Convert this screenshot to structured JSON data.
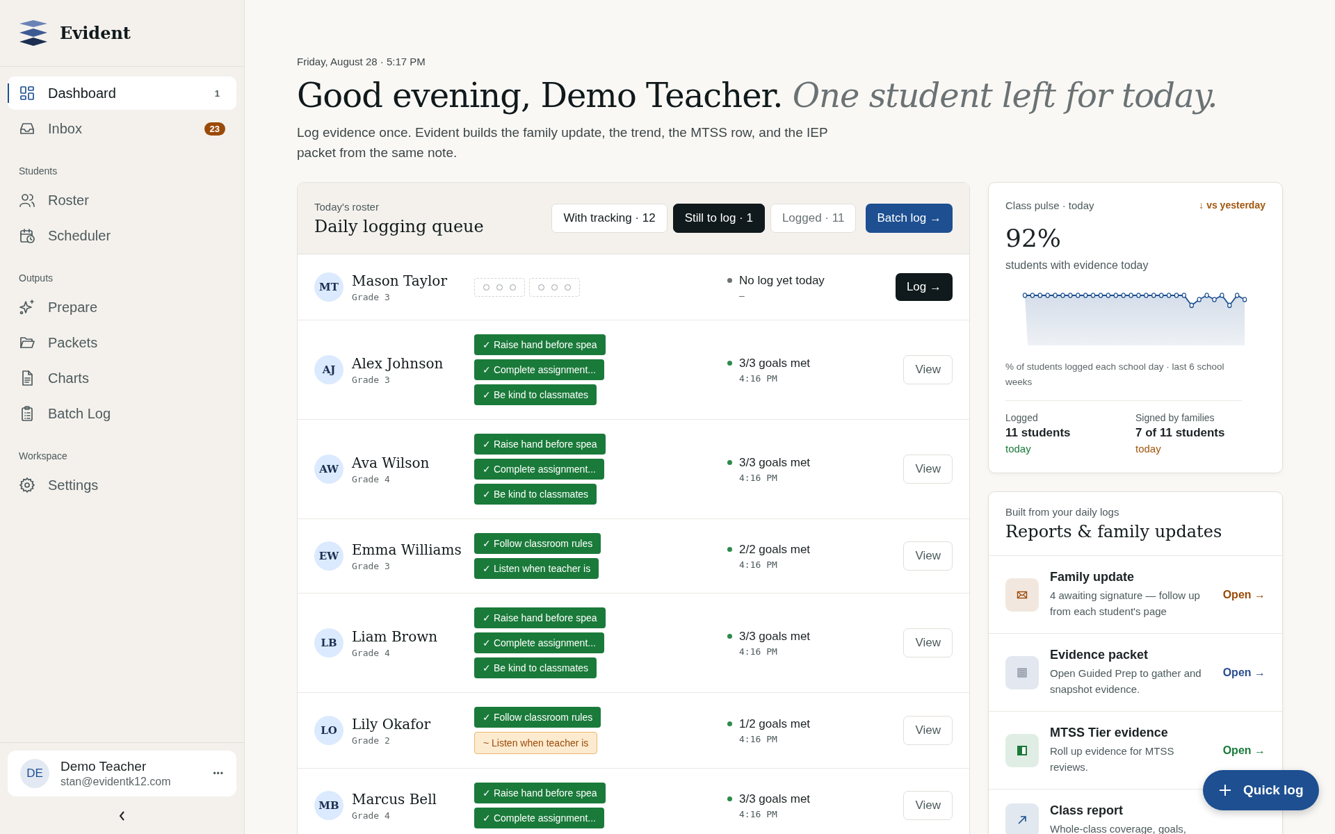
{
  "brand": {
    "name": "Evident"
  },
  "nav": [
    {
      "kind": "item",
      "label": "Dashboard",
      "selected": true,
      "badge": "1",
      "highlighted": false
    },
    {
      "kind": "item",
      "label": "Inbox",
      "selected": false,
      "badge": "23",
      "highlighted": true
    },
    {
      "kind": "section",
      "label": "Students"
    },
    {
      "kind": "item",
      "label": "Roster",
      "selected": false
    },
    {
      "kind": "item",
      "label": "Scheduler",
      "selected": false
    },
    {
      "kind": "section",
      "label": "Outputs"
    },
    {
      "kind": "item",
      "label": "Prepare",
      "selected": false
    },
    {
      "kind": "item",
      "label": "Packets",
      "selected": false
    },
    {
      "kind": "item",
      "label": "Charts",
      "selected": false
    },
    {
      "kind": "item",
      "label": "Batch Log",
      "selected": false
    },
    {
      "kind": "section",
      "label": "Workspace"
    },
    {
      "kind": "item",
      "label": "Settings",
      "selected": false
    }
  ],
  "user": {
    "initials": "DE",
    "name": "Demo Teacher",
    "email": "stan@evidentk12.com",
    "menu": "•••"
  },
  "header": {
    "date": "Friday, August 28 · 5:17 PM",
    "greeting": "Good evening, Demo Teacher.",
    "subtitle": "One student left for today.",
    "description": "Log evidence once. Evident builds the family update, the trend, the MTSS row, and the IEP packet from the same note."
  },
  "queue": {
    "eyebrow": "Today's roster",
    "title": "Daily logging queue",
    "filters": [
      {
        "label": "With tracking · 12",
        "selected": false,
        "muted": false
      },
      {
        "label": "Still to log · 1",
        "selected": true,
        "muted": false
      },
      {
        "label": "Logged · 11",
        "selected": false,
        "muted": true
      }
    ],
    "batch_button": "Batch log →",
    "rows": [
      {
        "initials": "MT",
        "name": "Mason Taylor",
        "grade": "Grade 3",
        "kind": "pending",
        "tags": [
          {
            "kind": "empty"
          },
          {
            "kind": "empty"
          }
        ],
        "status": "No log yet today",
        "time": "–",
        "action": "Log →"
      },
      {
        "initials": "AJ",
        "name": "Alex Johnson",
        "grade": "Grade 3",
        "kind": "logged",
        "tags": [
          {
            "kind": "met",
            "label": "✓ Raise hand before spea"
          },
          {
            "kind": "met",
            "label": "✓ Complete assignment..."
          },
          {
            "kind": "met",
            "label": "✓ Be kind to classmates"
          }
        ],
        "status": "3/3 goals met",
        "time": "4:16 PM",
        "action": "View"
      },
      {
        "initials": "AW",
        "name": "Ava Wilson",
        "grade": "Grade 4",
        "kind": "logged",
        "tags": [
          {
            "kind": "met",
            "label": "✓ Raise hand before spea"
          },
          {
            "kind": "met",
            "label": "✓ Complete assignment..."
          },
          {
            "kind": "met",
            "label": "✓ Be kind to classmates"
          }
        ],
        "status": "3/3 goals met",
        "time": "4:16 PM",
        "action": "View"
      },
      {
        "initials": "EW",
        "name": "Emma Williams",
        "grade": "Grade 3",
        "kind": "logged",
        "tags": [
          {
            "kind": "met",
            "label": "✓ Follow classroom rules"
          },
          {
            "kind": "met",
            "label": "✓ Listen when teacher is"
          }
        ],
        "status": "2/2 goals met",
        "time": "4:16 PM",
        "action": "View"
      },
      {
        "initials": "LB",
        "name": "Liam Brown",
        "grade": "Grade 4",
        "kind": "logged",
        "tags": [
          {
            "kind": "met",
            "label": "✓ Raise hand before spea"
          },
          {
            "kind": "met",
            "label": "✓ Complete assignment..."
          },
          {
            "kind": "met",
            "label": "✓ Be kind to classmates"
          }
        ],
        "status": "3/3 goals met",
        "time": "4:16 PM",
        "action": "View"
      },
      {
        "initials": "LO",
        "name": "Lily Okafor",
        "grade": "Grade 2",
        "kind": "logged",
        "tags": [
          {
            "kind": "met",
            "label": "✓ Follow classroom rules"
          },
          {
            "kind": "partial",
            "label": "~ Listen when teacher is"
          }
        ],
        "status": "1/2 goals met",
        "time": "4:16 PM",
        "action": "View"
      },
      {
        "initials": "MB",
        "name": "Marcus Bell",
        "grade": "Grade 4",
        "kind": "logged",
        "tags": [
          {
            "kind": "met",
            "label": "✓ Raise hand before spea"
          },
          {
            "kind": "met",
            "label": "✓ Complete assignment..."
          }
        ],
        "status": "3/3 goals met",
        "time": "4:16 PM",
        "action": "View"
      }
    ]
  },
  "pulse": {
    "eyebrow": "Class pulse · today",
    "trend": "↓ vs yesterday",
    "value": "92%",
    "caption": "students with evidence today",
    "chart_caption": "% of students logged each school day · last 6 school weeks",
    "stats": [
      {
        "label": "Logged",
        "value": "11 students",
        "note": "today",
        "color": "#1a7a3a"
      },
      {
        "label": "Signed by families",
        "value": "7 of 11 students",
        "note": "today",
        "color": "#a0570f"
      }
    ]
  },
  "reports": {
    "eyebrow": "Built from your daily logs",
    "title": "Reports & family updates",
    "items": [
      {
        "title": "Family update",
        "description": "4 awaiting signature — follow up from each student's page",
        "link": "Open →",
        "color": "#9a4a08"
      },
      {
        "title": "Evidence packet",
        "description": "Open Guided Prep to gather and snapshot evidence.",
        "link": "Open →",
        "color": "#2a4d8f"
      },
      {
        "title": "MTSS Tier evidence",
        "description": "Roll up evidence for MTSS reviews.",
        "link": "Open →",
        "color": "#1a7a3a"
      },
      {
        "title": "Class report",
        "description": "Whole-class coverage, goals,",
        "color": "#1d4f91"
      }
    ]
  },
  "quick_log": {
    "label": "Quick log"
  }
}
